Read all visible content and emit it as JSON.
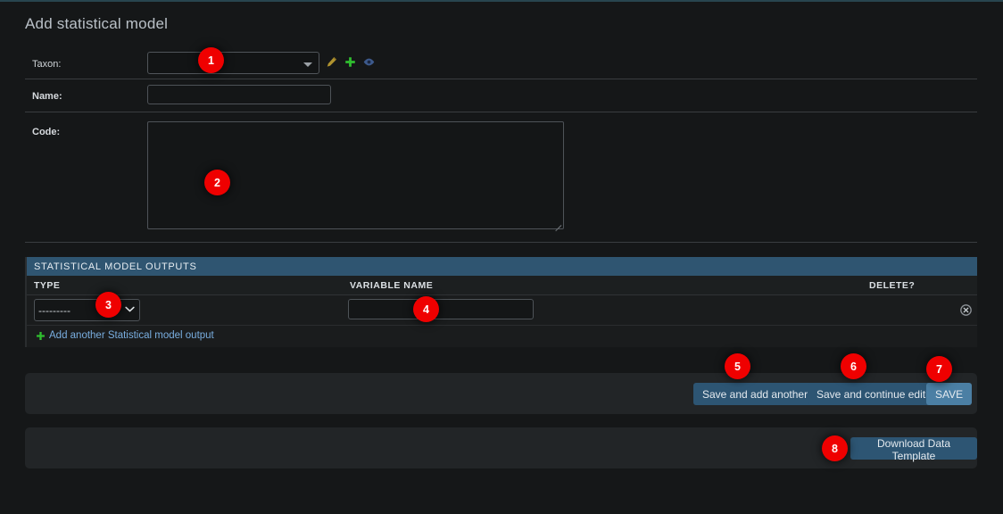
{
  "page": {
    "title": "Add statistical model"
  },
  "form": {
    "fields": [
      {
        "label": "Taxon:",
        "type": "select2",
        "value": "",
        "icons": [
          {
            "name": "edit-pencil-icon",
            "color": "#b0932f"
          },
          {
            "name": "add-plus-icon",
            "color": "#2fbf2f"
          },
          {
            "name": "view-eye-icon",
            "color": "#3d5a8c"
          }
        ]
      },
      {
        "label": "Name:",
        "type": "text",
        "value": "",
        "placeholder": ""
      },
      {
        "label": "Code:",
        "type": "textarea",
        "value": "",
        "placeholder": ""
      }
    ]
  },
  "inline_group": {
    "header": "STATISTICAL MODEL OUTPUTS",
    "columns": [
      "TYPE",
      "VARIABLE NAME",
      "DELETE?"
    ],
    "rows": [
      {
        "type_selected": "---------",
        "type_options": [
          "---------"
        ],
        "variable_name": "",
        "delete_icon": "delete-circle-x-icon"
      }
    ],
    "add_link": "Add another Statistical model output",
    "add_icon": "add-plus-icon"
  },
  "submit_row": {
    "buttons": [
      {
        "label": "Save and add another",
        "style": "default"
      },
      {
        "label": "Save and continue editing",
        "style": "default"
      },
      {
        "label": "SAVE",
        "style": "primary"
      }
    ]
  },
  "download_row": {
    "buttons": [
      {
        "label": "Download Data Template",
        "style": "default"
      }
    ]
  },
  "markers": [
    {
      "number": "1",
      "target": "taxon-select"
    },
    {
      "number": "2",
      "target": "code-textarea"
    },
    {
      "number": "3",
      "target": "output-type-select"
    },
    {
      "number": "4",
      "target": "output-variable-name-input"
    },
    {
      "number": "5",
      "target": "save-and-add-another-button"
    },
    {
      "number": "6",
      "target": "save-and-continue-editing-button"
    },
    {
      "number": "7",
      "target": "save-button"
    },
    {
      "number": "8",
      "target": "download-data-template-button"
    }
  ],
  "colors": {
    "background": "#151718",
    "group_header": "#2f5571",
    "button": "#2d5573",
    "button_primary": "#4b7fa4",
    "link": "#79aee0",
    "marker": "#ef0000"
  }
}
